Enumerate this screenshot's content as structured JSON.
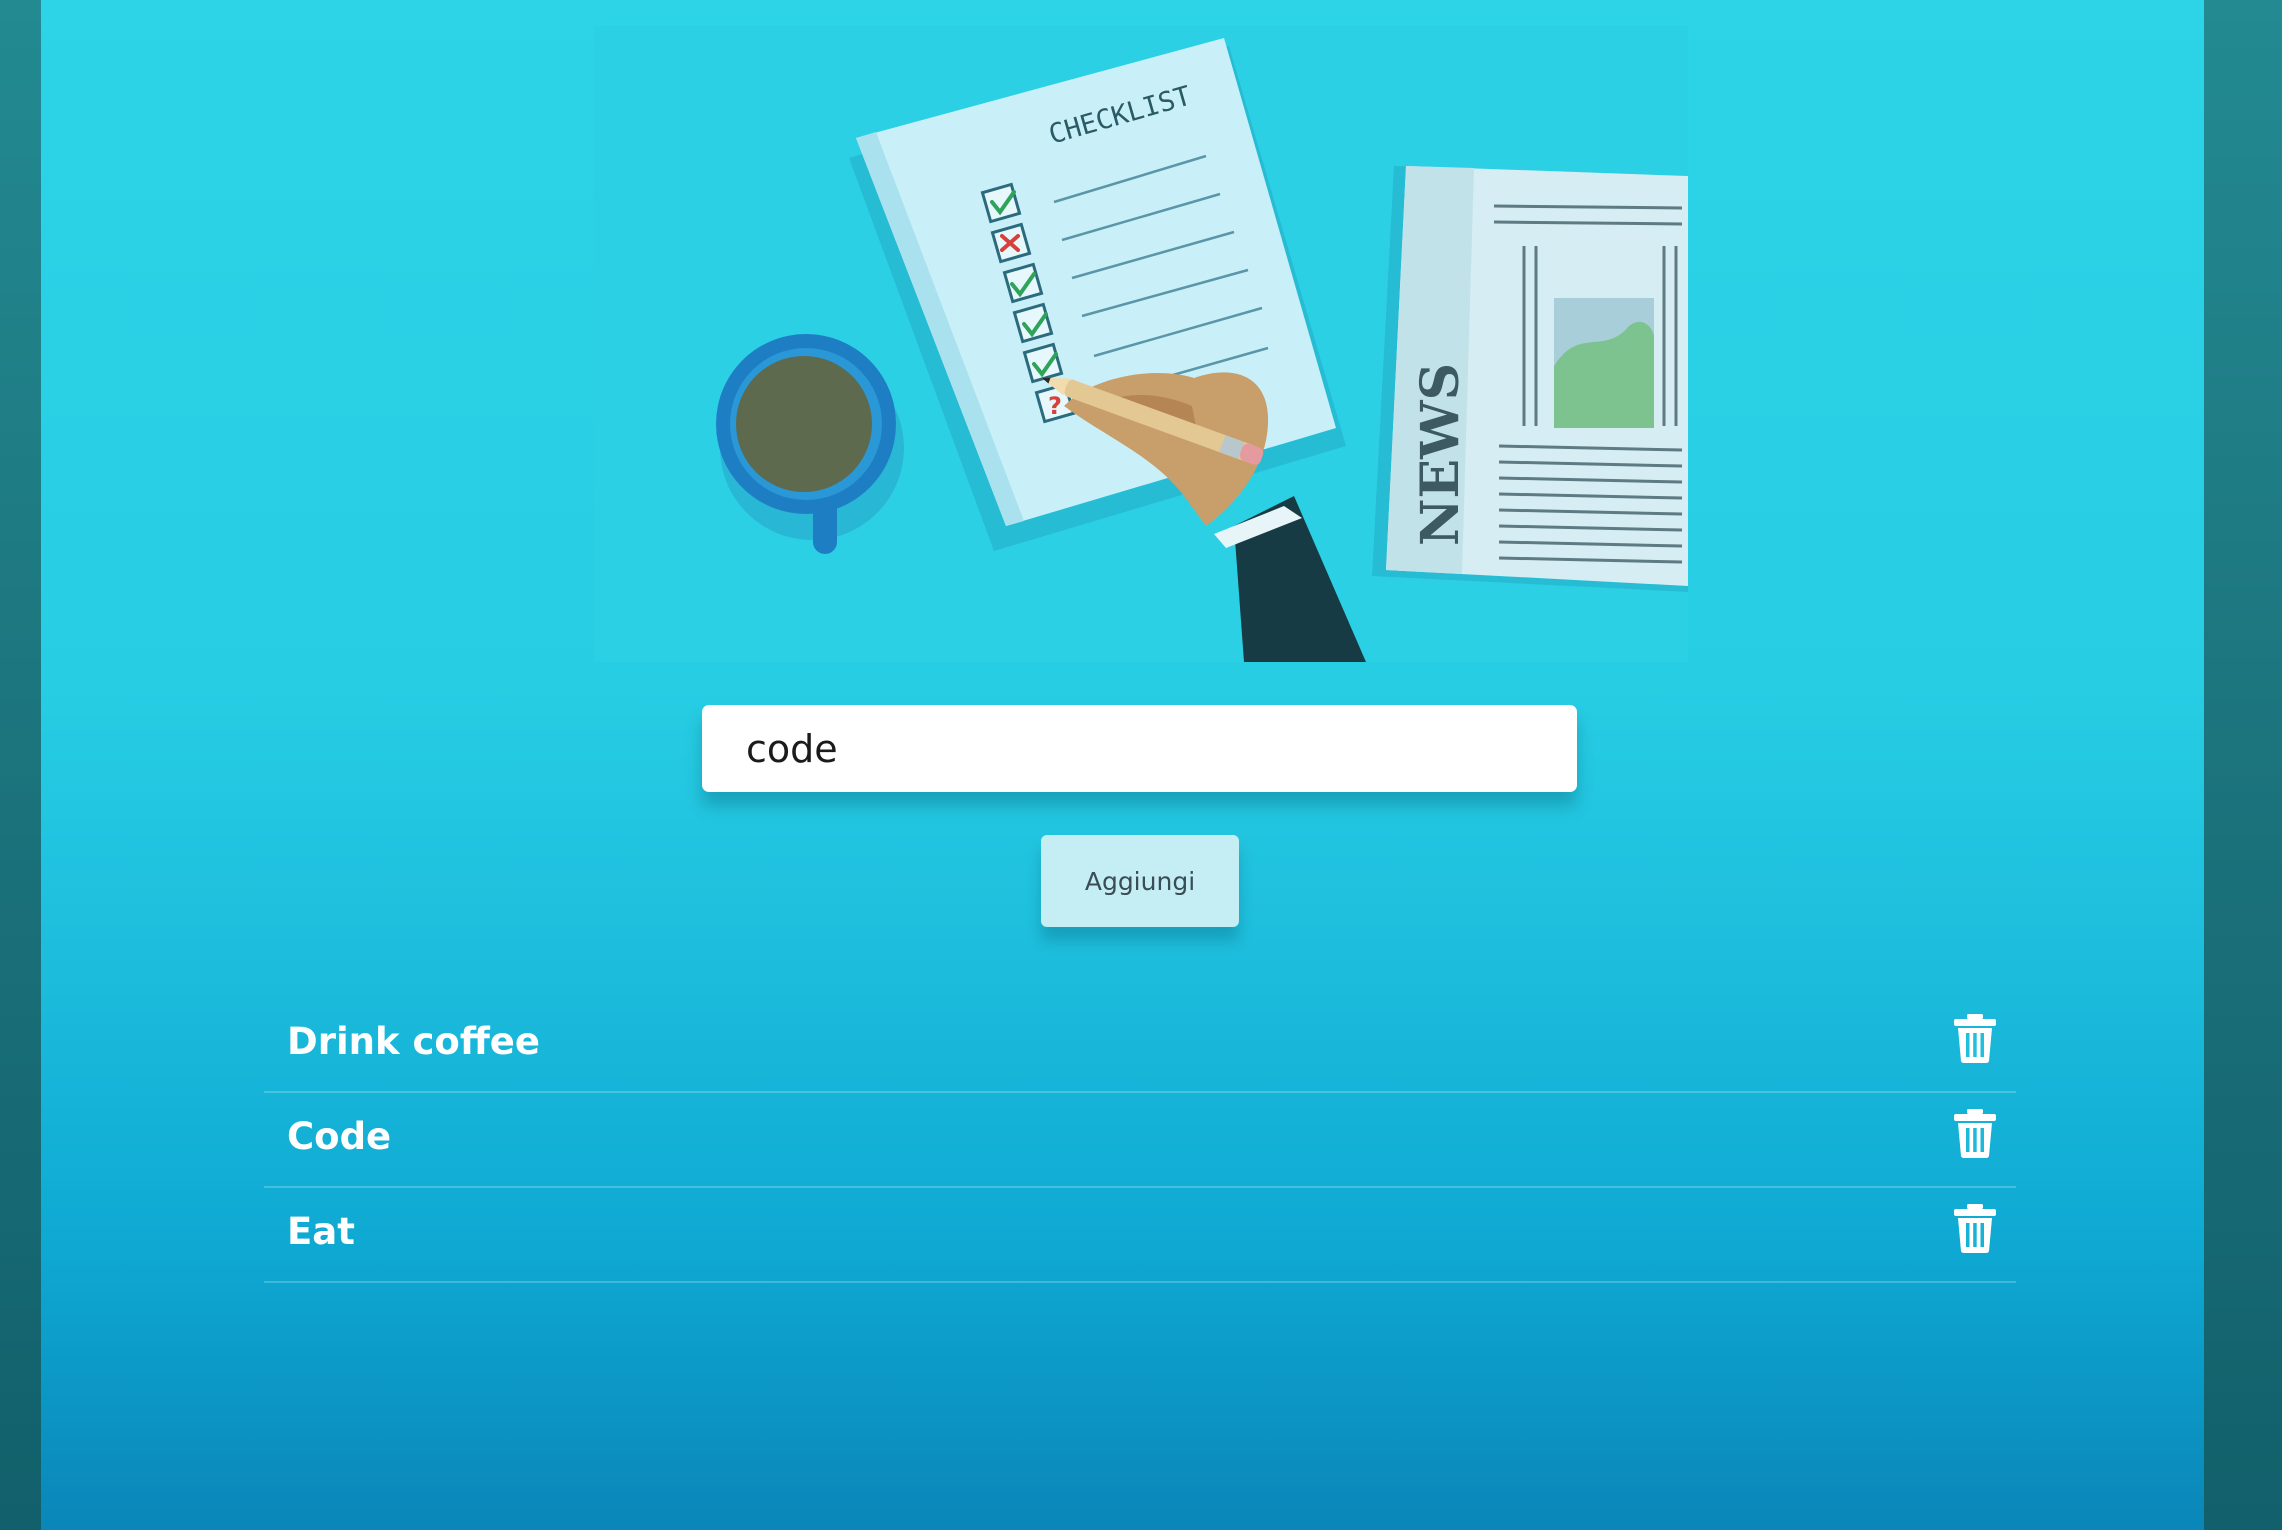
{
  "hero": {
    "checklist_title": "CHECKLIST",
    "newspaper_text": "NEWS"
  },
  "input": {
    "value": "code"
  },
  "add_button": {
    "label": "Aggiungi"
  },
  "todos": [
    {
      "text": "Drink coffee",
      "icon": "trash-icon"
    },
    {
      "text": "Code",
      "icon": "trash-icon"
    },
    {
      "text": "Eat",
      "icon": "trash-icon"
    }
  ],
  "colors": {
    "app_gradient_top": "#2dd3e6",
    "app_gradient_bottom": "#0a86b8",
    "outer_background": "#1d7c85",
    "button_background": "#c4edf4",
    "item_text": "#ffffff"
  }
}
